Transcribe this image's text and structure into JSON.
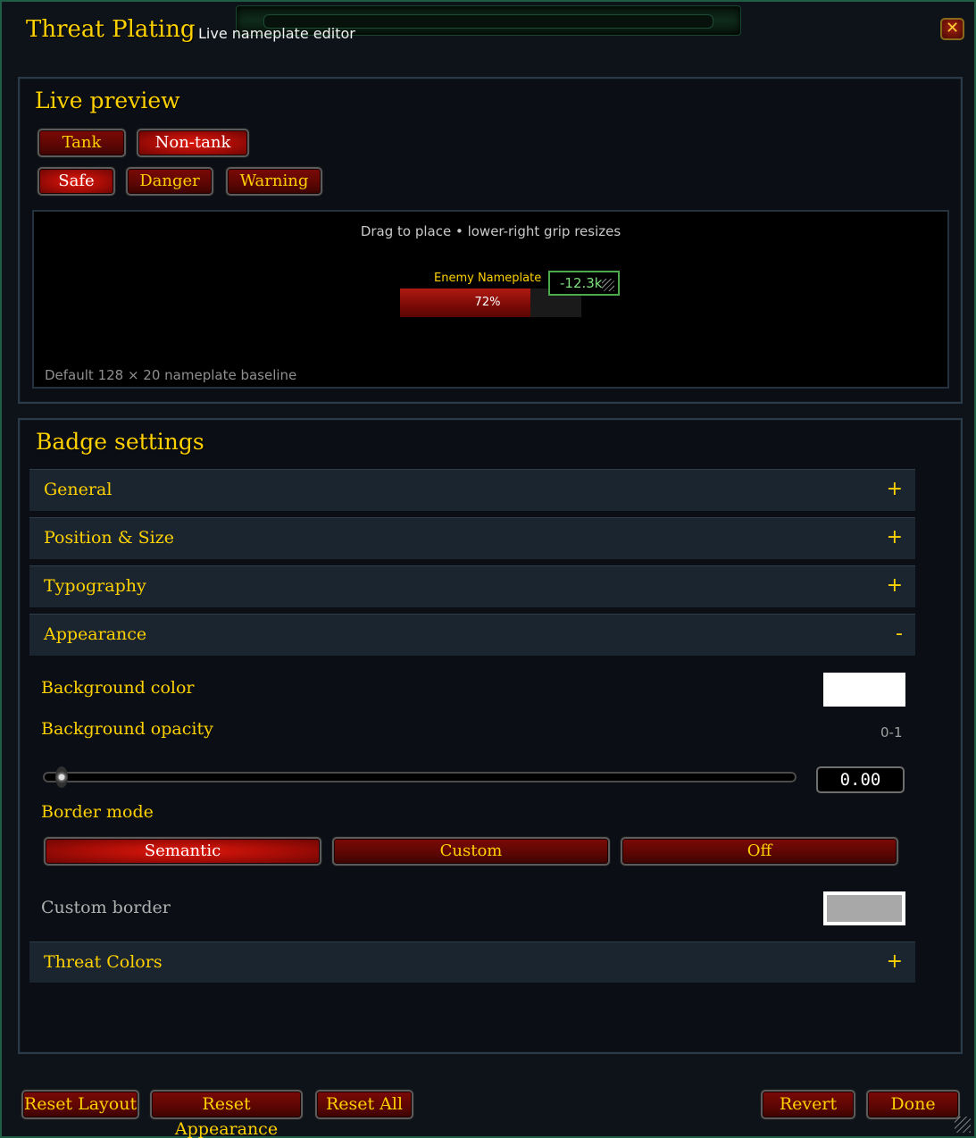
{
  "header": {
    "title": "Threat Plating",
    "subtitle": "Live nameplate editor",
    "close_glyph": "✕"
  },
  "preview": {
    "title": "Live preview",
    "role_buttons": [
      {
        "label": "Tank",
        "active": false
      },
      {
        "label": "Non-tank",
        "active": true
      }
    ],
    "state_buttons": [
      {
        "label": "Safe",
        "active": true
      },
      {
        "label": "Danger",
        "active": false
      },
      {
        "label": "Warning",
        "active": false
      }
    ],
    "hint": "Drag to place • lower-right grip resizes",
    "baseline": "Default 128 × 20 nameplate baseline",
    "nameplate": {
      "name": "Enemy Nameplate",
      "health_percent": 72,
      "health_label": "72%",
      "badge_text": "-12.3k"
    }
  },
  "badge": {
    "title": "Badge settings",
    "sections": [
      {
        "label": "General",
        "sign": "+"
      },
      {
        "label": "Position & Size",
        "sign": "+"
      },
      {
        "label": "Typography",
        "sign": "+"
      },
      {
        "label": "Appearance",
        "sign": "-"
      }
    ],
    "appearance": {
      "bg_color_label": "Background color",
      "bg_color": "#ffffff",
      "bg_opacity_label": "Background opacity",
      "bg_opacity_range": "0-1",
      "bg_opacity_value": "0.00",
      "border_mode_label": "Border mode",
      "border_modes": [
        {
          "label": "Semantic",
          "active": true
        },
        {
          "label": "Custom",
          "active": false
        },
        {
          "label": "Off",
          "active": false
        }
      ],
      "custom_border_label": "Custom border",
      "custom_border_color": "#a8a8a8"
    },
    "threat_colors": {
      "label": "Threat Colors",
      "sign": "+"
    }
  },
  "footer": {
    "reset_layout": "Reset Layout",
    "reset_appearance": "Reset Appearance",
    "reset_all": "Reset All",
    "revert": "Revert",
    "done": "Done"
  }
}
